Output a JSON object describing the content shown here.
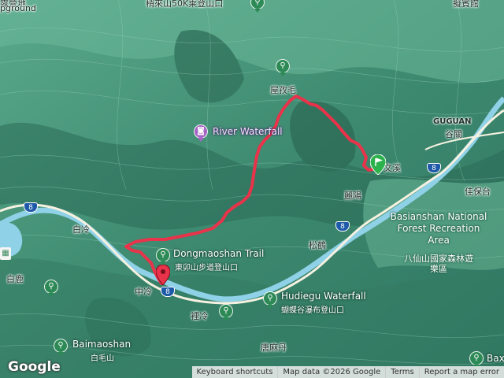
{
  "map": {
    "top_partial_label": "稍來山50K乘登山口",
    "top_left_partial": "露營地",
    "top_right_partial": "擬賓館",
    "left_partial": "pground",
    "route_color": "#e8334a",
    "terrain_color": "#3f8a73",
    "road_color": "#f2c14e",
    "river_color": "#8fd1e6"
  },
  "places": {
    "wuzhai": "屋孜毛",
    "river_waterfall": "River Waterfall",
    "guguan_en": "GUGUAN",
    "guguan_zh": "谷關",
    "wenxi": "文溪",
    "liyang": "麗陽",
    "jiabaotai": "佳保台",
    "baileng": "白冷",
    "songhe": "松鶴",
    "zhongleng": "中冷",
    "lileng": "裡冷",
    "bailu": "白鹿",
    "tangmadan": "唐麻丹",
    "baxianshan_park_en": "Basianshan National Forest Recreation Area",
    "baxianshan_park_zh": "八仙山國家森林遊樂區",
    "dongmaoshan_en": "Dongmaoshan Trail",
    "dongmaoshan_zh": "東卯山步道登山口",
    "hudiegu_en": "Hudiegu Waterfall",
    "hudiegu_zh": "蝴蝶谷瀑布登山口",
    "baimaoshan_en": "Baimaoshan",
    "baimaoshan_zh": "白毛山",
    "bax_partial": "Bax"
  },
  "highway": {
    "shield_label": "8"
  },
  "footer": {
    "logo": "Google",
    "keyboard": "Keyboard shortcuts",
    "mapdata": "Map data ©2026 Google",
    "terms": "Terms",
    "report": "Report a map error"
  },
  "icons": {
    "hiking": "hiker-icon",
    "waterfall": "camera-icon",
    "start": "green-flag-pin-icon",
    "end": "red-pin-icon",
    "park": "park-icon"
  }
}
